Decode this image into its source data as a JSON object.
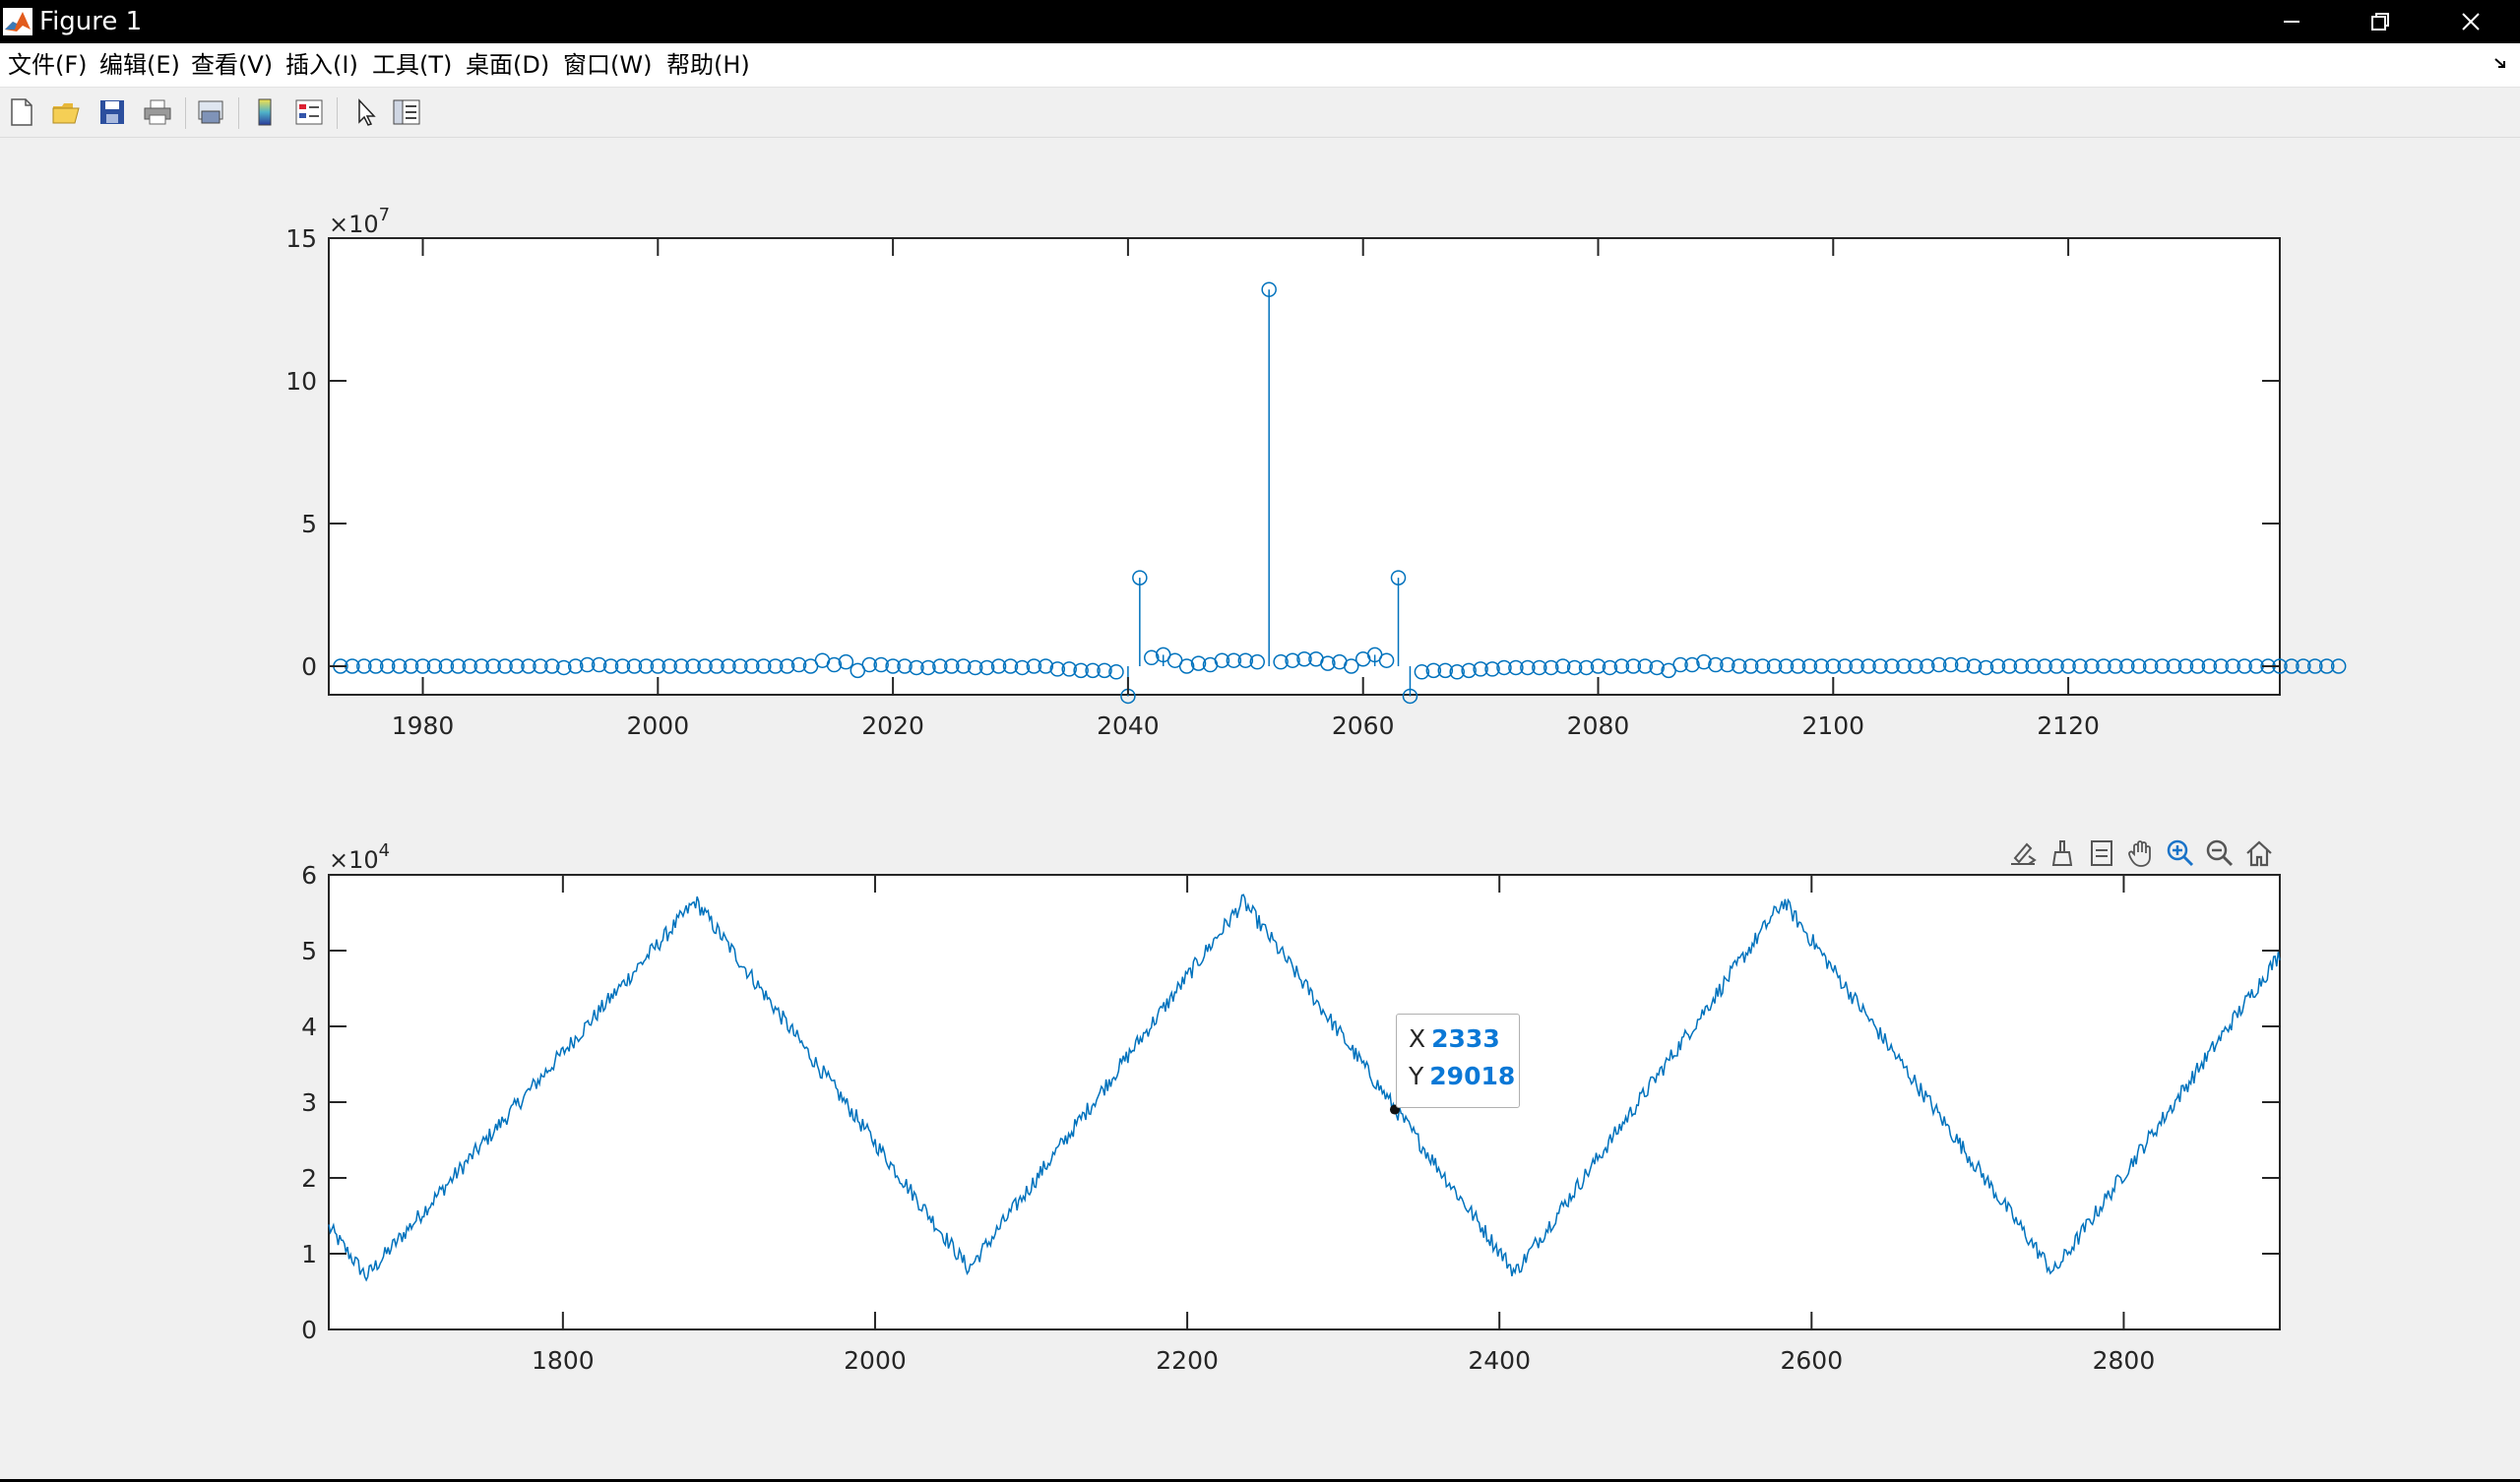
{
  "window": {
    "title": "Figure 1",
    "minimize_icon": "minimize-icon",
    "restore_icon": "restore-icon",
    "close_icon": "close-icon"
  },
  "menu": {
    "items": [
      {
        "label": "文件(F)"
      },
      {
        "label": "编辑(E)"
      },
      {
        "label": "查看(V)"
      },
      {
        "label": "插入(I)"
      },
      {
        "label": "工具(T)"
      },
      {
        "label": "桌面(D)"
      },
      {
        "label": "窗口(W)"
      },
      {
        "label": "帮助(H)"
      }
    ],
    "undock_icon": "undock-arrow-icon"
  },
  "toolbar": {
    "buttons": [
      "new-figure-icon",
      "open-file-icon",
      "save-icon",
      "print-icon",
      "link-plot-icon",
      "insert-colorbar-icon",
      "insert-legend-icon",
      "edit-plot-icon",
      "property-inspector-icon"
    ]
  },
  "axes_toolbar": {
    "buttons": [
      "brush-export-icon",
      "brush-icon",
      "data-tip-icon",
      "pan-hand-icon",
      "zoom-in-icon",
      "zoom-out-icon",
      "restore-view-home-icon"
    ]
  },
  "colors": {
    "series": "#0072BD",
    "axes": "#262626",
    "tip_value": "#0b78d6",
    "figure_bg": "#f0f0f0"
  },
  "chart_data": [
    {
      "type": "stem",
      "title": "",
      "xlabel": "",
      "ylabel": "",
      "xlim": [
        1972,
        2138
      ],
      "ylim": [
        -1,
        15
      ],
      "exponent_label": "×10",
      "exponent": "7",
      "xticks": [
        1980,
        2000,
        2020,
        2040,
        2060,
        2080,
        2100,
        2120
      ],
      "yticks": [
        0,
        5,
        10,
        15
      ],
      "grid": false,
      "marker": "circle",
      "x_start": 1973,
      "values": [
        0,
        0,
        0,
        0,
        0,
        0,
        0,
        0,
        0,
        0,
        0,
        0,
        0,
        0,
        0,
        0,
        0,
        0,
        0,
        -0.05,
        0,
        0.05,
        0.05,
        0,
        0,
        0,
        0,
        0,
        0,
        0,
        0,
        0,
        0,
        0,
        0,
        0,
        0,
        0,
        0,
        0.05,
        0,
        0.2,
        0.05,
        0.15,
        -0.15,
        0.05,
        0.05,
        0,
        0,
        -0.05,
        -0.05,
        0,
        0,
        0,
        -0.05,
        -0.05,
        0,
        0,
        -0.05,
        0,
        0,
        -0.1,
        -0.1,
        -0.15,
        -0.15,
        -0.15,
        -0.2,
        -1.05,
        3.1,
        0.3,
        0.4,
        0.2,
        0,
        0.1,
        0.05,
        0.2,
        0.2,
        0.2,
        0.15,
        13.2,
        0.15,
        0.2,
        0.25,
        0.25,
        0.1,
        0.15,
        0,
        0.25,
        0.4,
        0.2,
        3.1,
        -1.05,
        -0.2,
        -0.15,
        -0.15,
        -0.2,
        -0.15,
        -0.1,
        -0.1,
        -0.05,
        -0.05,
        -0.05,
        -0.05,
        -0.05,
        0,
        -0.05,
        -0.05,
        0,
        -0.05,
        0,
        0,
        0,
        -0.05,
        -0.15,
        0.05,
        0.05,
        0.15,
        0.05,
        0.05,
        0,
        0,
        0,
        0,
        0,
        0,
        0,
        0,
        0,
        0,
        0,
        0,
        0,
        0,
        0,
        0,
        0,
        0.05,
        0.05,
        0.05,
        0,
        -0.05,
        0,
        0,
        0,
        0,
        0,
        0,
        0,
        0,
        0,
        0,
        0,
        0,
        0,
        0,
        0,
        0,
        0,
        0,
        0,
        0,
        0,
        0,
        0,
        0,
        0,
        0,
        0,
        0,
        0,
        0
      ]
    },
    {
      "type": "line",
      "title": "",
      "xlabel": "",
      "ylabel": "",
      "xlim": [
        1650,
        2900
      ],
      "ylim": [
        0,
        6
      ],
      "exponent_label": "×10",
      "exponent": "4",
      "xticks": [
        1800,
        2000,
        2200,
        2400,
        2600,
        2800
      ],
      "yticks": [
        0,
        1,
        2,
        3,
        4,
        5,
        6
      ],
      "grid": false,
      "x": [
        1650,
        1674,
        1885,
        2060,
        2236,
        2410,
        2582,
        2755,
        2900
      ],
      "values": [
        1.35,
        0.7,
        5.65,
        0.8,
        5.65,
        0.75,
        5.65,
        0.75,
        4.95
      ],
      "datatip": {
        "x_label": "X",
        "x": "2333",
        "y_label": "Y",
        "y": "29018",
        "x_value": 2333,
        "y_value": 2.9018
      }
    }
  ]
}
